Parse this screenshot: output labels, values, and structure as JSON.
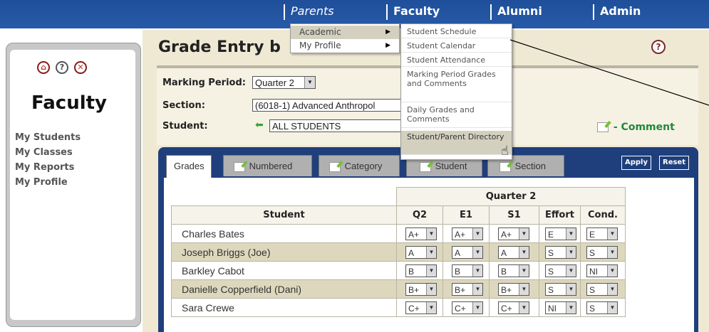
{
  "nav": {
    "parents": "Parents",
    "faculty": "Faculty",
    "alumni": "Alumni",
    "admin": "Admin"
  },
  "sidebar": {
    "title": "Faculty",
    "links": [
      "My Students",
      "My Classes",
      "My Reports",
      "My Profile"
    ]
  },
  "page": {
    "title": "Grade Entry b"
  },
  "form": {
    "marking_period_label": "Marking Period:",
    "marking_period_value": "Quarter 2",
    "section_label": "Section:",
    "section_value": "(6018-1) Advanced Anthropol",
    "student_label": "Student:",
    "student_value": "ALL STUDENTS",
    "comment_legend": "- Comment"
  },
  "tabs": [
    "Grades",
    "Numbered",
    "Category",
    "Student",
    "Section"
  ],
  "buttons": {
    "apply": "Apply",
    "reset": "Reset"
  },
  "table": {
    "group_header": "Quarter 2",
    "columns": [
      "Student",
      "Q2",
      "E1",
      "S1",
      "Effort",
      "Cond."
    ],
    "rows": [
      {
        "student": "Charles Bates",
        "q2": "A+",
        "e1": "A+",
        "s1": "A+",
        "effort": "E",
        "cond": "E"
      },
      {
        "student": "Joseph Briggs (Joe)",
        "q2": "A",
        "e1": "A",
        "s1": "A",
        "effort": "S",
        "cond": "S"
      },
      {
        "student": "Barkley Cabot",
        "q2": "B",
        "e1": "B",
        "s1": "B",
        "effort": "S",
        "cond": "NI"
      },
      {
        "student": "Danielle Copperfield (Dani)",
        "q2": "B+",
        "e1": "B+",
        "s1": "B+",
        "effort": "S",
        "cond": "S"
      },
      {
        "student": "Sara Crewe",
        "q2": "C+",
        "e1": "C+",
        "s1": "C+",
        "effort": "NI",
        "cond": "S"
      }
    ]
  },
  "menu_level1": {
    "items": [
      "Academic",
      "My Profile"
    ]
  },
  "menu_level2": {
    "items": [
      "Student Schedule",
      "Student Calendar",
      "Student Attendance",
      "Marking Period Grades and Comments",
      "Daily Grades and Comments",
      "Student/Parent Directory"
    ]
  },
  "icons": {
    "home": "home-icon",
    "help": "help-icon",
    "close": "close-icon",
    "page_help": "help-icon",
    "back": "arrow-left-icon",
    "comment": "pencil-icon",
    "cursor": "hand-cursor-icon"
  }
}
